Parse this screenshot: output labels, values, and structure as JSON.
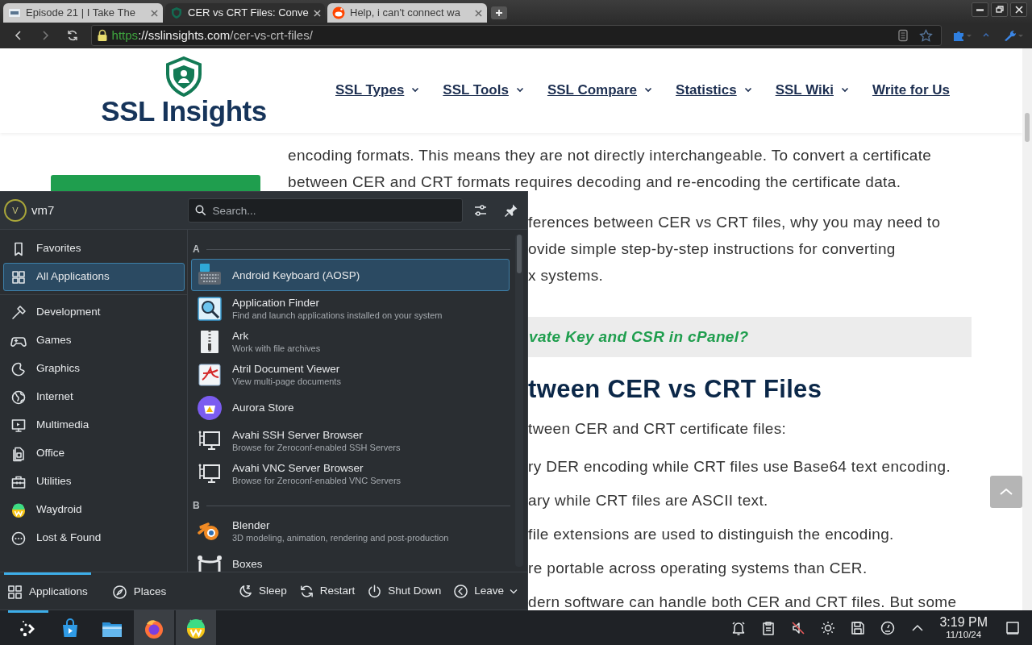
{
  "browser": {
    "tabs": [
      {
        "title": "Episode 21 | I Take The",
        "selected": false
      },
      {
        "title": "CER vs CRT Files: Conve",
        "selected": true
      },
      {
        "title": "Help, i can't connect wa",
        "selected": false
      }
    ],
    "address": {
      "scheme": "https",
      "host": "://sslinsights.com",
      "path": "/cer-vs-crt-files/"
    }
  },
  "site": {
    "logo": "SSL Insights",
    "nav": [
      {
        "label": "SSL Types",
        "has_menu": true
      },
      {
        "label": "SSL Tools",
        "has_menu": true
      },
      {
        "label": "SSL Compare",
        "has_menu": true
      },
      {
        "label": "Statistics",
        "has_menu": true
      },
      {
        "label": "SSL Wiki",
        "has_menu": true
      },
      {
        "label": "Write for Us",
        "has_menu": false
      }
    ]
  },
  "article": {
    "above_menu": [
      "encoding formats. This means they are not directly interchangeable. To convert a certificate",
      "between CER and CRT formats requires decoding and re-encoding the certificate data."
    ],
    "beside_menu": [
      {
        "kind": "text",
        "lines": [
          "ferences between CER vs CRT files, why you may need to",
          "ovide simple step-by-step instructions for converting",
          "x systems."
        ]
      },
      {
        "kind": "callout",
        "lines": [
          "vate Key and CSR in cPanel?"
        ]
      },
      {
        "kind": "heading",
        "lines": [
          "tween CER vs CRT Files"
        ]
      },
      {
        "kind": "text",
        "lines": [
          "tween CER and CRT certificate files:"
        ]
      },
      {
        "kind": "list",
        "lines": [
          "ry DER encoding while CRT files use Base64 text encoding.",
          "ary while CRT files are ASCII text.",
          "file extensions are used to distinguish the encoding.",
          "re portable across operating systems than CER.",
          "dern software can handle both CER and CRT files. But some"
        ]
      }
    ]
  },
  "launcher": {
    "user": "vm7",
    "avatar_letter": "V",
    "search": {
      "placeholder": "Search..."
    },
    "category_groups": [
      [
        {
          "label": "Favorites",
          "selected": false
        },
        {
          "label": "All Applications",
          "selected": true
        }
      ],
      [
        {
          "label": "Development",
          "selected": false
        },
        {
          "label": "Games",
          "selected": false
        },
        {
          "label": "Graphics",
          "selected": false
        },
        {
          "label": "Internet",
          "selected": false
        },
        {
          "label": "Multimedia",
          "selected": false
        },
        {
          "label": "Office",
          "selected": false
        },
        {
          "label": "Utilities",
          "selected": false
        },
        {
          "label": "Waydroid",
          "selected": false
        },
        {
          "label": "Lost & Found",
          "selected": false
        }
      ]
    ],
    "sections": [
      {
        "letter": "A",
        "apps": [
          {
            "name": "Android Keyboard (AOSP)",
            "selected": true
          },
          {
            "name": "Application Finder",
            "description": "Find and launch applications installed on your system",
            "selected": false
          },
          {
            "name": "Ark",
            "description": "Work with file archives",
            "selected": false
          },
          {
            "name": "Atril Document Viewer",
            "description": "View multi-page documents",
            "selected": false
          },
          {
            "name": "Aurora Store",
            "selected": false
          },
          {
            "name": "Avahi SSH Server Browser",
            "description": "Browse for Zeroconf-enabled SSH Servers",
            "selected": false
          },
          {
            "name": "Avahi VNC Server Browser",
            "description": "Browse for Zeroconf-enabled VNC Servers",
            "selected": false
          }
        ]
      },
      {
        "letter": "B",
        "apps": [
          {
            "name": "Blender",
            "description": "3D modeling, animation, rendering and post-production",
            "selected": false
          },
          {
            "name": "Boxes",
            "selected": false
          }
        ]
      }
    ],
    "tabs": [
      {
        "label": "Applications",
        "selected": true
      },
      {
        "label": "Places",
        "selected": false
      }
    ],
    "actions": [
      {
        "label": "Sleep",
        "has_menu": false
      },
      {
        "label": "Restart",
        "has_menu": false
      },
      {
        "label": "Shut Down",
        "has_menu": false
      },
      {
        "label": "Leave",
        "has_menu": true
      }
    ]
  },
  "taskbar": {
    "launcher": {
      "open": true
    },
    "apps": [
      {
        "running": false
      },
      {
        "running": false
      },
      {
        "running": true
      },
      {
        "running": true
      }
    ],
    "clock": {
      "time": "3:19 PM",
      "date": "11/10/24"
    }
  }
}
